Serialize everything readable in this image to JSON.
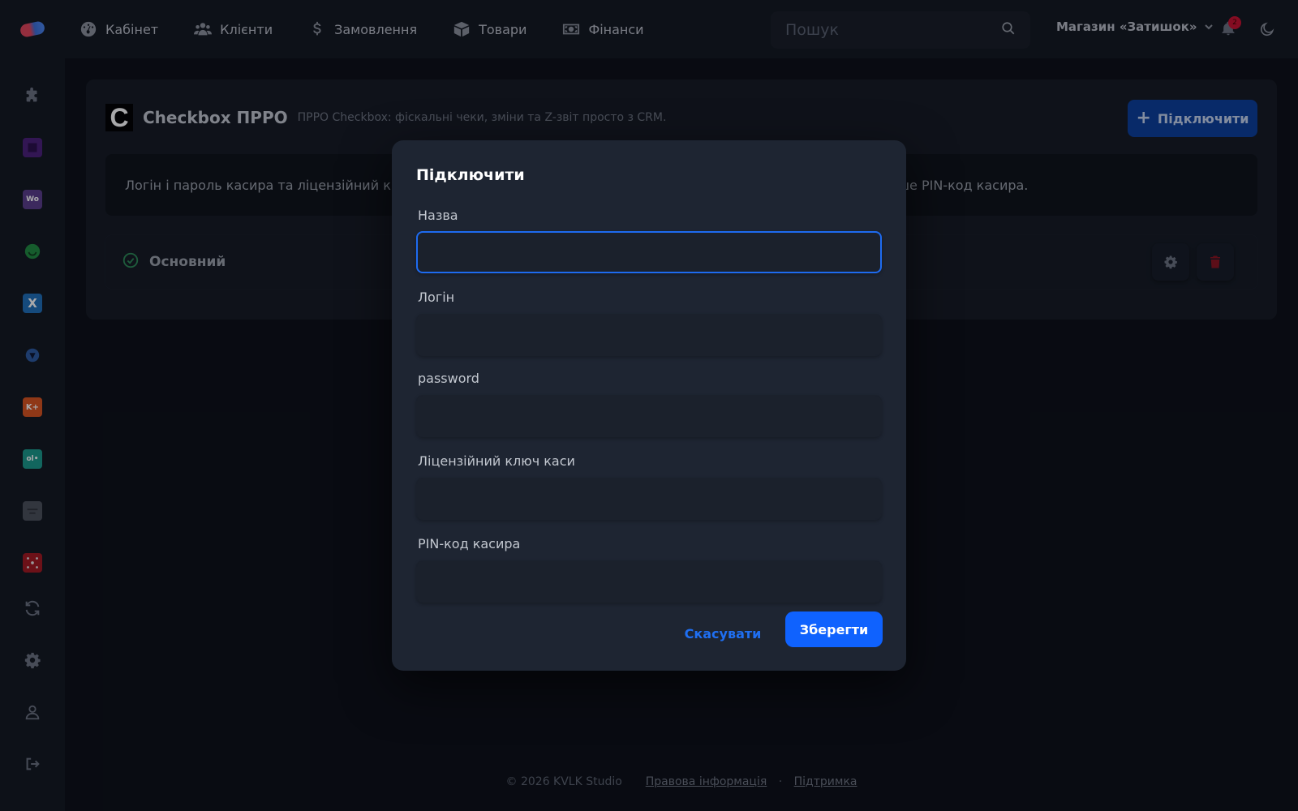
{
  "nav": {
    "items": [
      {
        "label": "Кабінет",
        "icon": "gauge-icon"
      },
      {
        "label": "Клієнти",
        "icon": "users-icon"
      },
      {
        "label": "Замовлення",
        "icon": "dollar-icon"
      },
      {
        "label": "Товари",
        "icon": "box-icon"
      },
      {
        "label": "Фінанси",
        "icon": "money-icon"
      }
    ],
    "search_placeholder": "Пошук",
    "store_name": "Магазин «Затишок»",
    "notifications_count": "2"
  },
  "card": {
    "logo_letter": "C",
    "title": "Checkbox ПРРО",
    "subtitle": "ПРРО Checkbox: фіскальні чеки, зміни та Z-звіт просто з CRM.",
    "connect_label": "Підключити",
    "info_text_start": "Логін і пароль касира та ліцензійний к",
    "info_text_end": "ише PIN-код касира.",
    "row_name": "Основний"
  },
  "modal": {
    "title": "Підключити",
    "fields": [
      {
        "label": "Назва",
        "value": ""
      },
      {
        "label": "Логін",
        "value": ""
      },
      {
        "label": "password",
        "value": ""
      },
      {
        "label": "Ліцензійний ключ каси",
        "value": ""
      },
      {
        "label": "PIN-код касира",
        "value": ""
      }
    ],
    "cancel_label": "Скасувати",
    "save_label": "Зберегти"
  },
  "footer": {
    "copyright": "© 2026 KVLK Studio",
    "legal_link": "Правова інформація",
    "separator": "·",
    "support_link": "Підтримка"
  },
  "colors": {
    "accent": "#0f62fe",
    "danger": "#c8102e",
    "success": "#2c8a57"
  }
}
